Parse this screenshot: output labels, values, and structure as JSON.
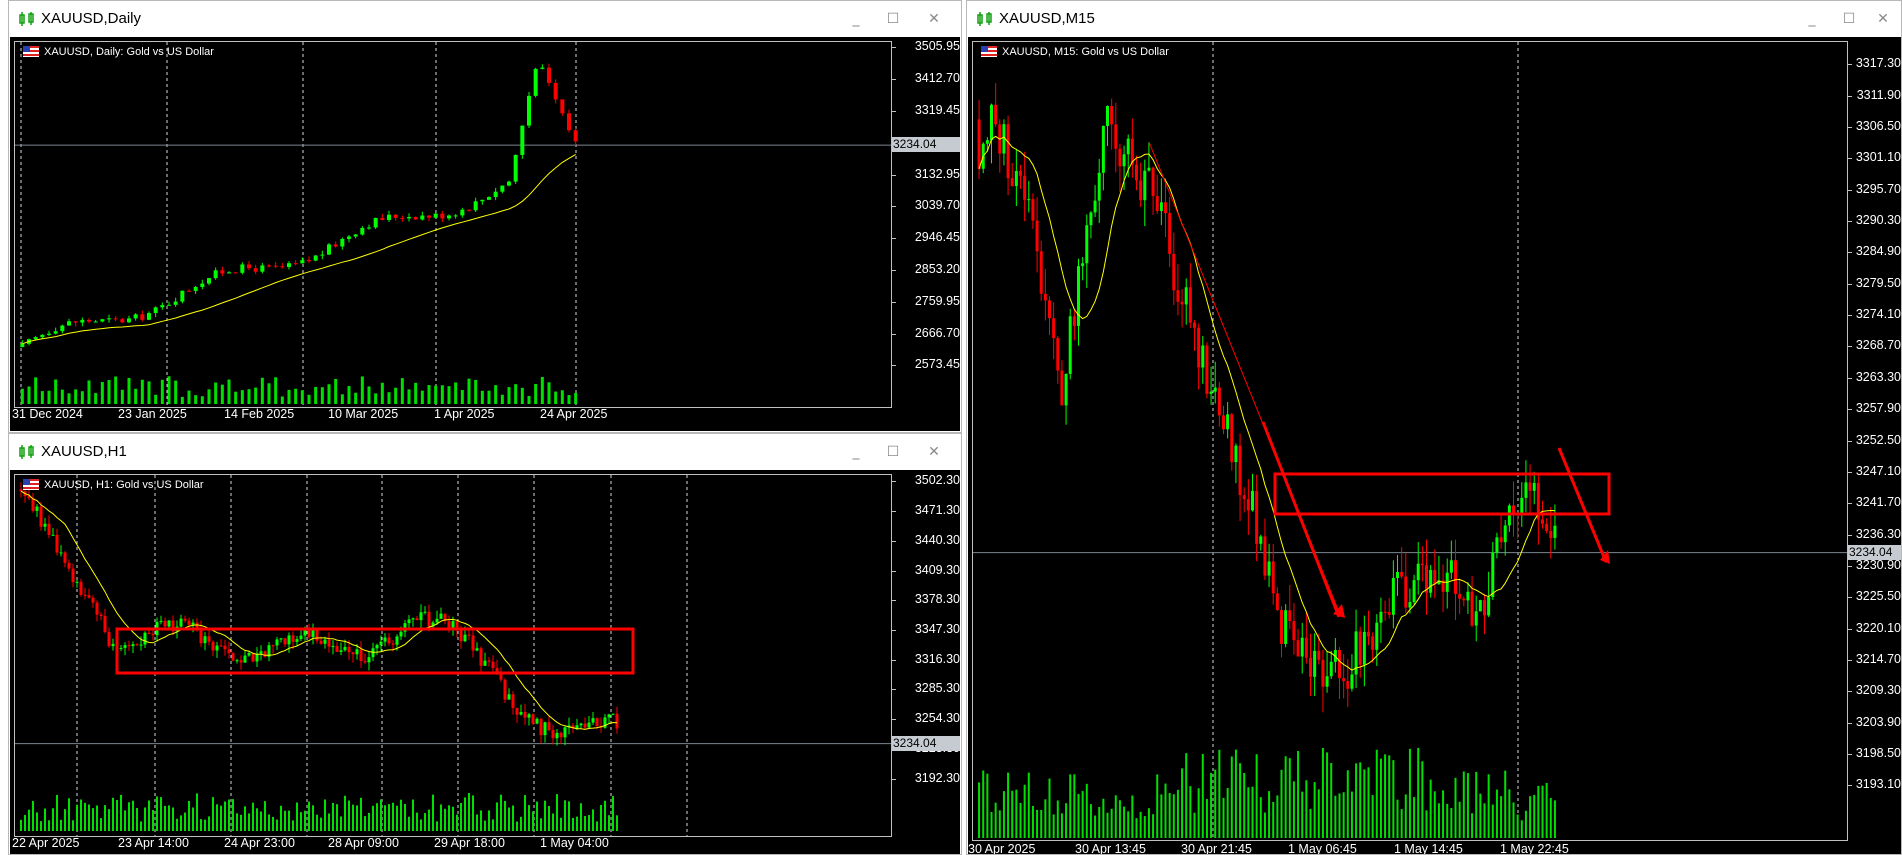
{
  "theme": {
    "up_color": "#00ff00",
    "down_color": "#ff0000",
    "ma_color": "#ffff00",
    "volume_color": "#00e000",
    "annotation_color": "#ff0000",
    "background": "#000000",
    "current_price_line": "#7b8791",
    "grid": "#ffffff"
  },
  "window_controls": {
    "minimize": "_",
    "maximize": "☐",
    "close": "✕"
  },
  "windows": [
    {
      "id": "daily",
      "title": "XAUUSD,Daily",
      "legend": "XAUUSD, Daily:  Gold vs US Dollar",
      "price_labels": [
        "3505.95",
        "3412.70",
        "3319.45",
        "3226.20",
        "3132.95",
        "3039.70",
        "2946.45",
        "2853.20",
        "2759.95",
        "2666.70",
        "2573.45"
      ],
      "current_price": "3234.04",
      "time_labels": [
        "31 Dec 2024",
        "23 Jan 2025",
        "14 Feb 2025",
        "10 Mar 2025",
        "1 Apr 2025",
        "24 Apr 2025"
      ],
      "price_range": [
        2545,
        3525
      ],
      "series_start": 2630,
      "series_end": 3234,
      "series_count": 84,
      "series_peak": 3500,
      "series_peak_index": 76,
      "ma_start": 2640,
      "ma_end": 3240
    },
    {
      "id": "h1",
      "title": "XAUUSD,H1",
      "legend": "XAUUSD, H1:  Gold vs US Dollar",
      "price_labels": [
        "3502.30",
        "3471.30",
        "3440.30",
        "3409.30",
        "3378.30",
        "3347.30",
        "3316.30",
        "3285.30",
        "3254.30",
        "3223.30",
        "3192.30"
      ],
      "current_price": "3234.04",
      "time_labels": [
        "22 Apr 2025",
        "23 Apr 14:00",
        "24 Apr 23:00",
        "28 Apr 09:00",
        "29 Apr 18:00",
        "1 May 04:00"
      ],
      "price_range": [
        3170,
        3510
      ],
      "series_start": 3495,
      "series_end": 3232,
      "series_count": 150,
      "ma_start": 3480,
      "ma_end": 3234
    },
    {
      "id": "m15",
      "title": "XAUUSD,M15",
      "legend": "XAUUSD, M15:  Gold vs US Dollar",
      "price_labels": [
        "3317.30",
        "3311.90",
        "3306.50",
        "3301.10",
        "3295.70",
        "3290.30",
        "3284.90",
        "3279.50",
        "3274.10",
        "3268.70",
        "3263.30",
        "3257.90",
        "3252.50",
        "3247.10",
        "3241.70",
        "3236.30",
        "3230.90",
        "3225.50",
        "3220.10",
        "3214.70",
        "3209.30",
        "3203.90",
        "3198.50",
        "3193.10"
      ],
      "current_price": "3234.04",
      "time_labels": [
        "30 Apr 2025",
        "30 Apr 13:45",
        "30 Apr 21:45",
        "1 May 06:45",
        "1 May 14:45",
        "1 May 22:45"
      ],
      "price_range": [
        3189,
        3321
      ],
      "series_start": 3308,
      "series_end": 3234,
      "series_count": 140,
      "ma_start": 3310,
      "ma_end": 3234
    }
  ]
}
